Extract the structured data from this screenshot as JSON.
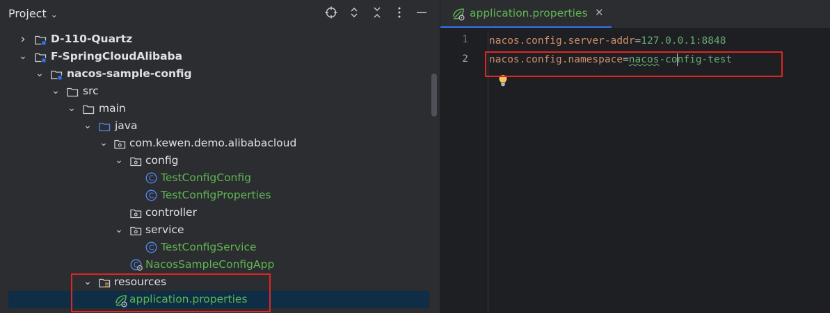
{
  "project": {
    "title": "Project",
    "header_icons": [
      "crosshair-icon",
      "expand-icon",
      "collapse-icon",
      "more-icon",
      "minimize-icon"
    ]
  },
  "tree": {
    "items": [
      {
        "label": "D-110-Quartz",
        "arrow": "›",
        "icon": "module-folder-icon"
      },
      {
        "label": "F-SpringCloudAlibaba",
        "arrow": "⌄",
        "icon": "module-folder-icon"
      },
      {
        "label": "nacos-sample-config",
        "arrow": "⌄",
        "icon": "module-folder-icon"
      },
      {
        "label": "src",
        "arrow": "⌄",
        "icon": "folder-icon"
      },
      {
        "label": "main",
        "arrow": "⌄",
        "icon": "folder-icon"
      },
      {
        "label": "java",
        "arrow": "⌄",
        "icon": "source-folder-icon"
      },
      {
        "label": "com.kewen.demo.alibabacloud",
        "arrow": "⌄",
        "icon": "package-icon"
      },
      {
        "label": "config",
        "arrow": "⌄",
        "icon": "package-icon"
      },
      {
        "label": "TestConfigConfig",
        "arrow": "",
        "icon": "class-icon"
      },
      {
        "label": "TestConfigProperties",
        "arrow": "",
        "icon": "class-icon"
      },
      {
        "label": "controller",
        "arrow": "",
        "icon": "package-icon"
      },
      {
        "label": "service",
        "arrow": "⌄",
        "icon": "package-icon"
      },
      {
        "label": "TestConfigService",
        "arrow": "",
        "icon": "class-icon"
      },
      {
        "label": "NacosSampleConfigApp",
        "arrow": "",
        "icon": "spring-boot-class-icon"
      },
      {
        "label": "resources",
        "arrow": "⌄",
        "icon": "resources-folder-icon"
      },
      {
        "label": "application.properties",
        "arrow": "",
        "icon": "spring-properties-icon"
      }
    ]
  },
  "editor": {
    "tab": {
      "label": "application.properties",
      "close": "✕"
    },
    "line_numbers": [
      "1",
      "2"
    ],
    "lines": [
      {
        "key": "nacos.config.server-addr",
        "eq": "=",
        "value": "127.0.0.1:8848"
      },
      {
        "key": "nacos.config.namespace",
        "eq": "=",
        "value_a": "nacos",
        "value_b": "-co",
        "value_c": "nfig-test"
      }
    ]
  },
  "colors": {
    "highlight_box": "#e02525",
    "selection": "#0f2e45",
    "spring_green": "#5fb552",
    "property_key": "#cf8e6d",
    "property_value": "#6aab73"
  }
}
